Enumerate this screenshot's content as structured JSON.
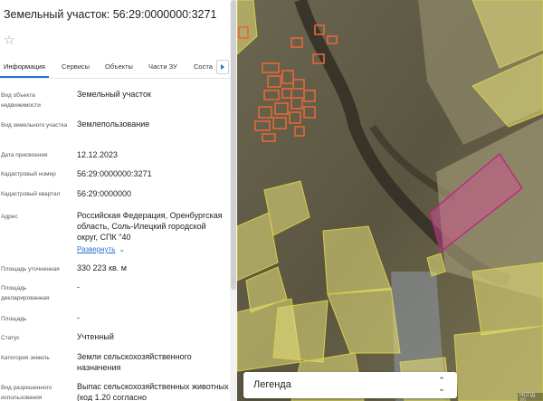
{
  "panel": {
    "title": "Земельный участок: 56:29:0000000:3271",
    "favorite_icon": "star-outline-icon",
    "tabs": [
      "Информация",
      "Сервисы",
      "Объекты",
      "Части ЗУ",
      "Соста"
    ],
    "active_tab": 0,
    "rows": [
      {
        "label": "Вид объекта недвижимости",
        "value": "Земельный участок"
      },
      {
        "label": "Вид земельного участка",
        "value": "Землепользование"
      },
      {
        "label": "Дата присвоения",
        "value": "12.12.2023"
      },
      {
        "label": "Кадастровый номер",
        "value": "56:29:0000000:3271"
      },
      {
        "label": "Кадастровый квартал",
        "value": "56:29:0000000"
      },
      {
        "label": "Адрес",
        "value": "Российская Федерация, Оренбургская область, Соль-Илецкий городской округ, СПК \"40",
        "expand": "Развернуть"
      },
      {
        "label": "Площадь уточненная",
        "value": "330 223 кв. м"
      },
      {
        "label": "Площадь декларированная",
        "value": "-"
      },
      {
        "label": "Площадь",
        "value": "-"
      },
      {
        "label": "Статус",
        "value": "Учтенный"
      },
      {
        "label": "Категория земель",
        "value": "Земли сельскохозяйственного назначения"
      },
      {
        "label": "Вид разрешенного использования",
        "value": "Выпас сельскохозяйственных животных (код 1.20 согласно"
      }
    ]
  },
  "map": {
    "legend_label": "Легенда",
    "legend_icon": "sort-arrows-icon",
    "attribution": "НСПД 20",
    "colors": {
      "parcel_fill": "#e6e07a",
      "parcel_stroke": "#d8cf4a",
      "selected_fill": "#d84d9a",
      "selected_stroke": "#c01f7e",
      "building_fill": "#e5683a"
    }
  }
}
